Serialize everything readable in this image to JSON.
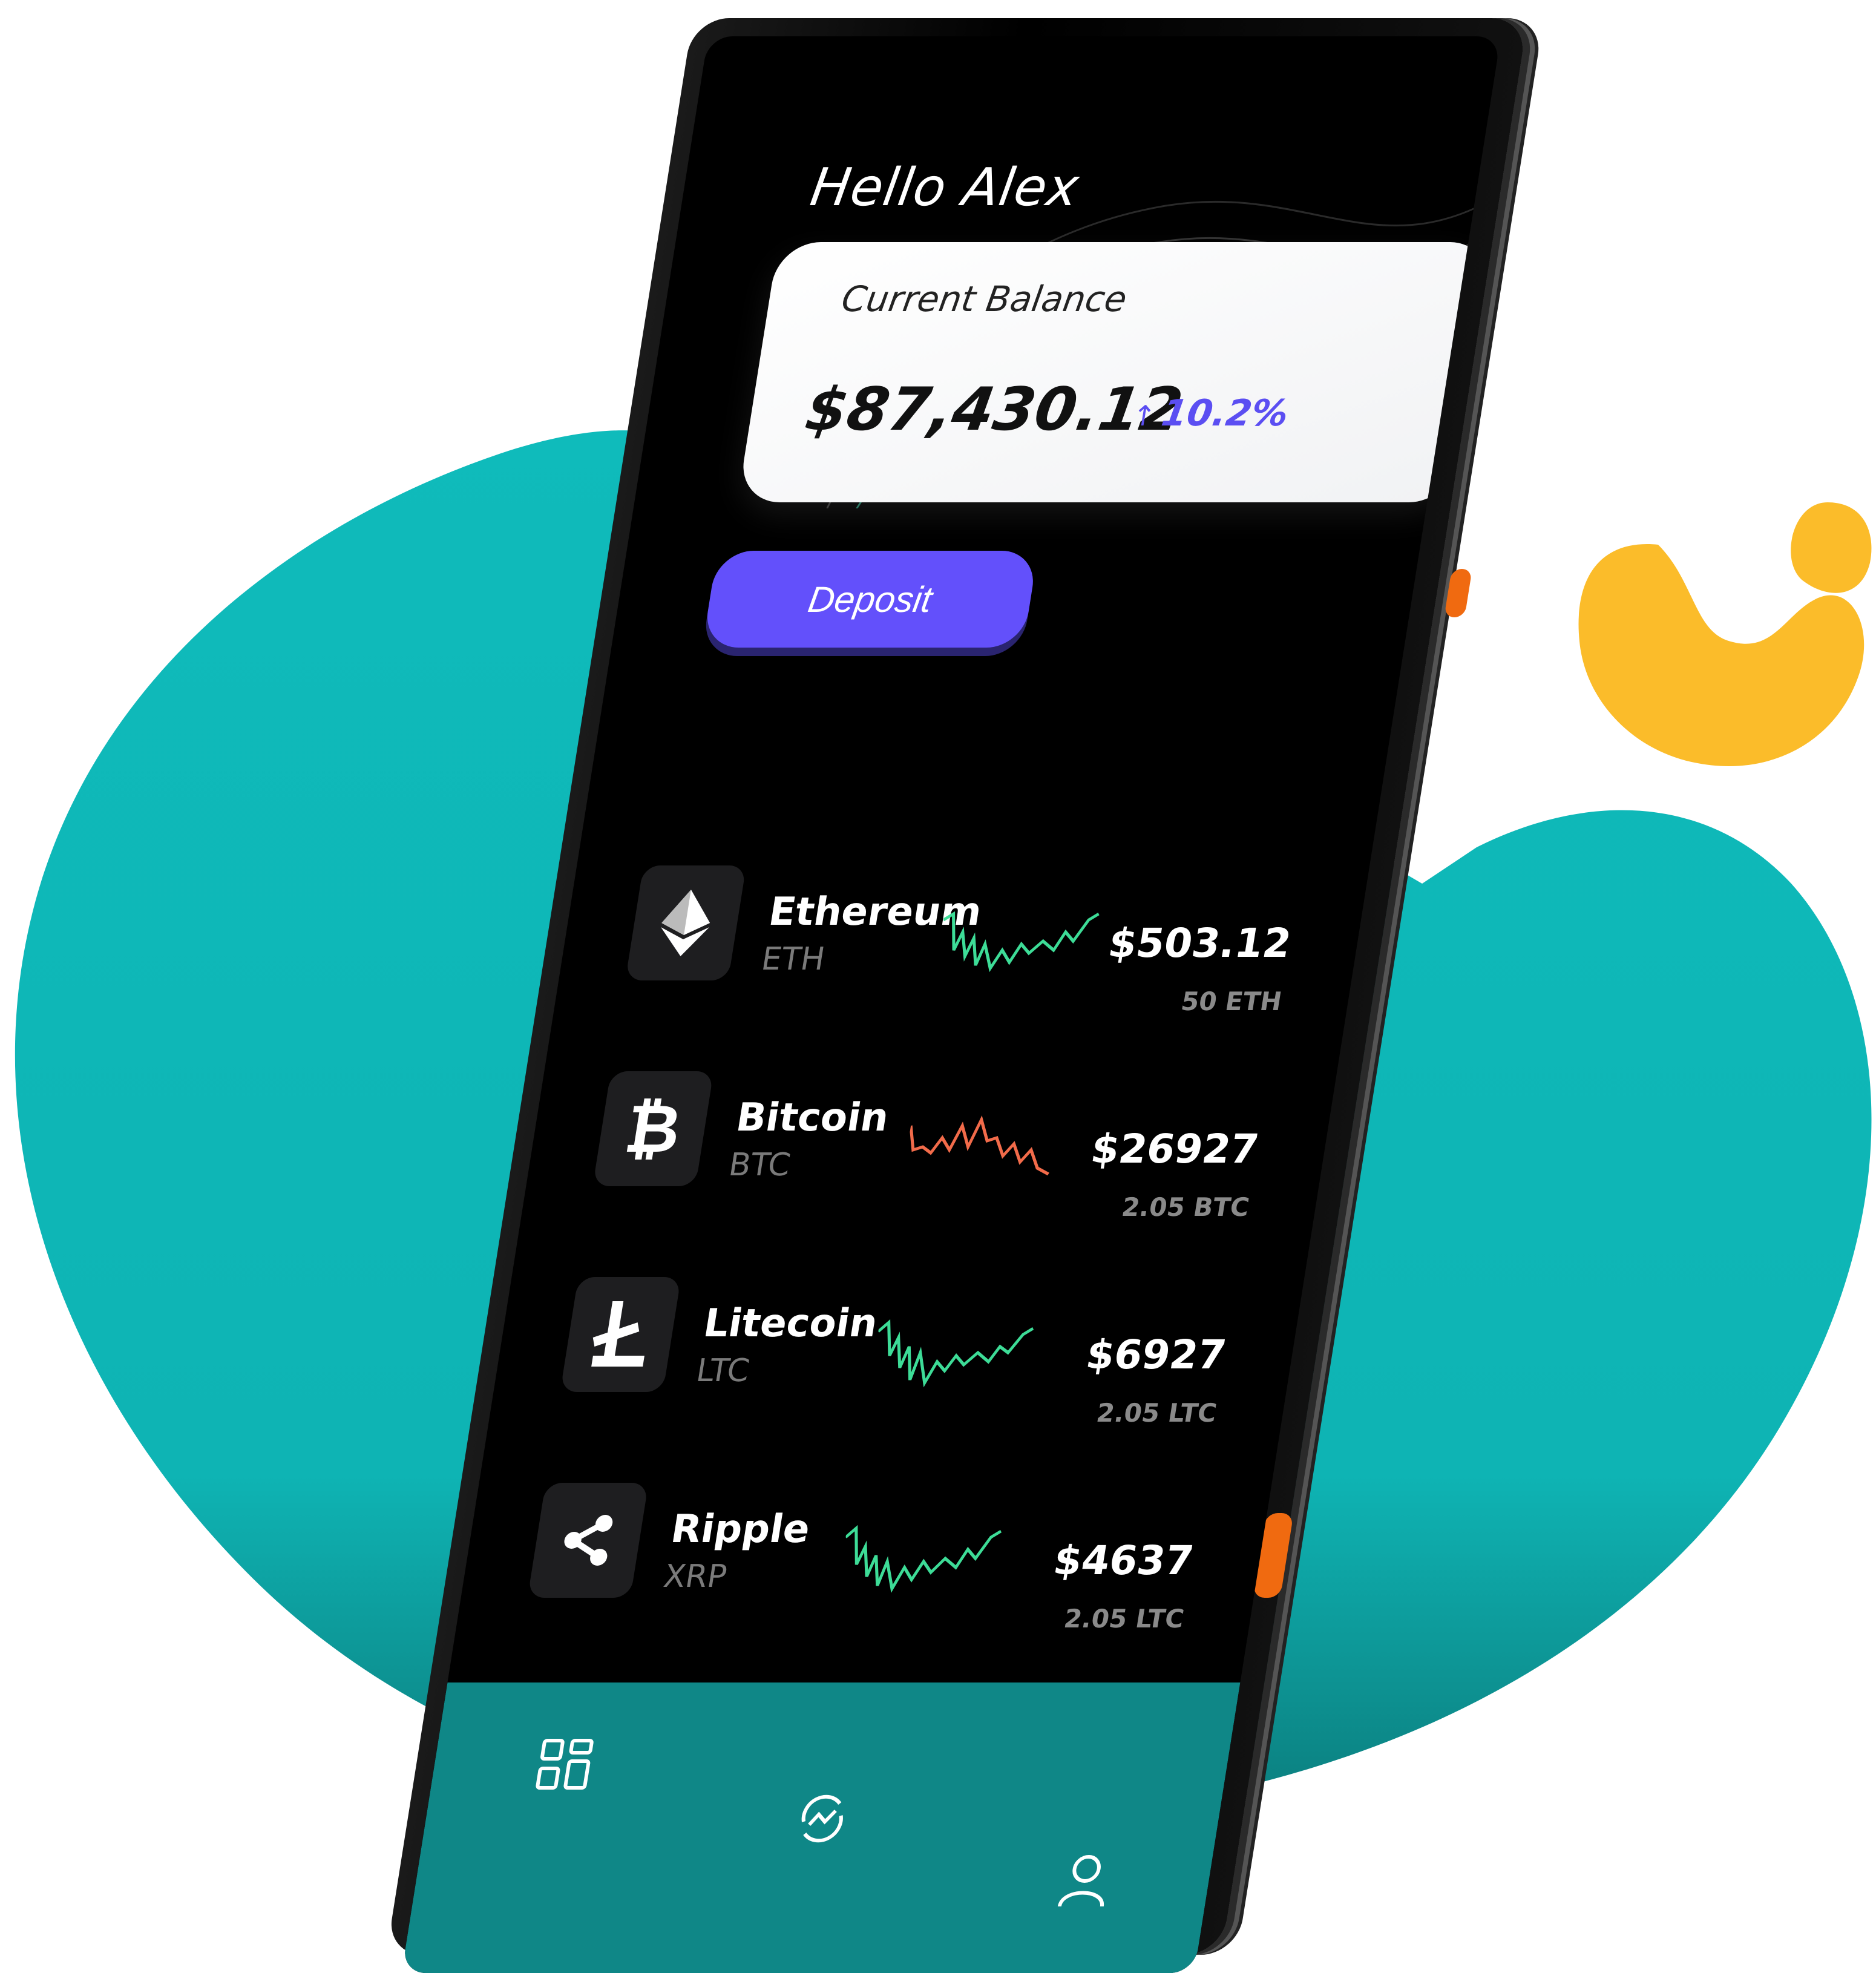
{
  "app": {
    "greeting": "Hello Alex",
    "balance": {
      "label": "Current Balance",
      "value": "$87,430.12",
      "change": "10.2%",
      "change_arrow": "↑"
    },
    "deposit_label": "Deposit",
    "coins": [
      {
        "name": "Ethereum",
        "ticker": "ETH",
        "price": "$503.12",
        "holding": "50 ETH",
        "icon": "ethereum-icon",
        "trend_color": "#3ddc97"
      },
      {
        "name": "Bitcoin",
        "ticker": "BTC",
        "price": "$26927",
        "holding": "2.05 BTC",
        "icon": "bitcoin-icon",
        "trend_color": "#f26b4a"
      },
      {
        "name": "Litecoin",
        "ticker": "LTC",
        "price": "$6927",
        "holding": "2.05 LTC",
        "icon": "litecoin-icon",
        "trend_color": "#3ddc97"
      },
      {
        "name": "Ripple",
        "ticker": "XRP",
        "price": "$4637",
        "holding": "2.05 LTC",
        "icon": "ripple-icon",
        "trend_color": "#3ddc97"
      }
    ],
    "nav": [
      "dashboard-icon",
      "exchange-icon",
      "profile-icon"
    ]
  },
  "colors": {
    "teal": "#0fbbbb",
    "accent_purple": "#6350fb",
    "yellow": "#fbbc2a",
    "nav_teal": "#0f8787"
  }
}
